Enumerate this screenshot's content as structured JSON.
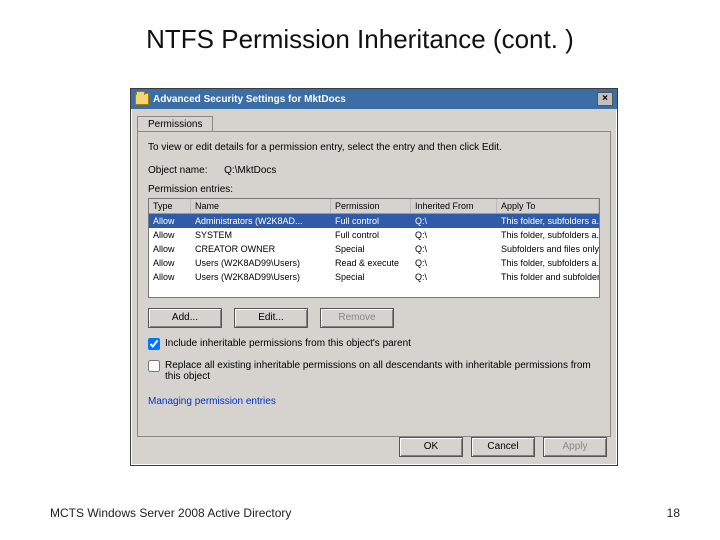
{
  "slide": {
    "title": "NTFS Permission Inheritance (cont. )",
    "footer_left": "MCTS Windows Server 2008 Active Directory",
    "footer_right": "18"
  },
  "dialog": {
    "title": "Advanced Security Settings for MktDocs",
    "tab": "Permissions",
    "instruction": "To view or edit details for a permission entry, select the entry and then click Edit.",
    "object_label": "Object name:",
    "object_value": "Q:\\MktDocs",
    "entries_label": "Permission entries:",
    "columns": {
      "type": "Type",
      "name": "Name",
      "perm": "Permission",
      "inh": "Inherited From",
      "apply": "Apply To"
    },
    "rows": [
      {
        "type": "Allow",
        "name": "Administrators (W2K8AD...",
        "perm": "Full control",
        "inh": "Q:\\",
        "apply": "This folder, subfolders a...",
        "sel": true
      },
      {
        "type": "Allow",
        "name": "SYSTEM",
        "perm": "Full control",
        "inh": "Q:\\",
        "apply": "This folder, subfolders a...",
        "sel": false
      },
      {
        "type": "Allow",
        "name": "CREATOR OWNER",
        "perm": "Special",
        "inh": "Q:\\",
        "apply": "Subfolders and files only",
        "sel": false
      },
      {
        "type": "Allow",
        "name": "Users (W2K8AD99\\Users)",
        "perm": "Read & execute",
        "inh": "Q:\\",
        "apply": "This folder, subfolders a...",
        "sel": false
      },
      {
        "type": "Allow",
        "name": "Users (W2K8AD99\\Users)",
        "perm": "Special",
        "inh": "Q:\\",
        "apply": "This folder and subfolders",
        "sel": false
      }
    ],
    "buttons": {
      "add": "Add...",
      "edit": "Edit...",
      "remove": "Remove"
    },
    "check1": "Include inheritable permissions from this object's parent",
    "check2": "Replace all existing inheritable permissions on all descendants with inheritable permissions from this object",
    "link": "Managing permission entries",
    "ok": "OK",
    "cancel": "Cancel",
    "apply": "Apply"
  }
}
